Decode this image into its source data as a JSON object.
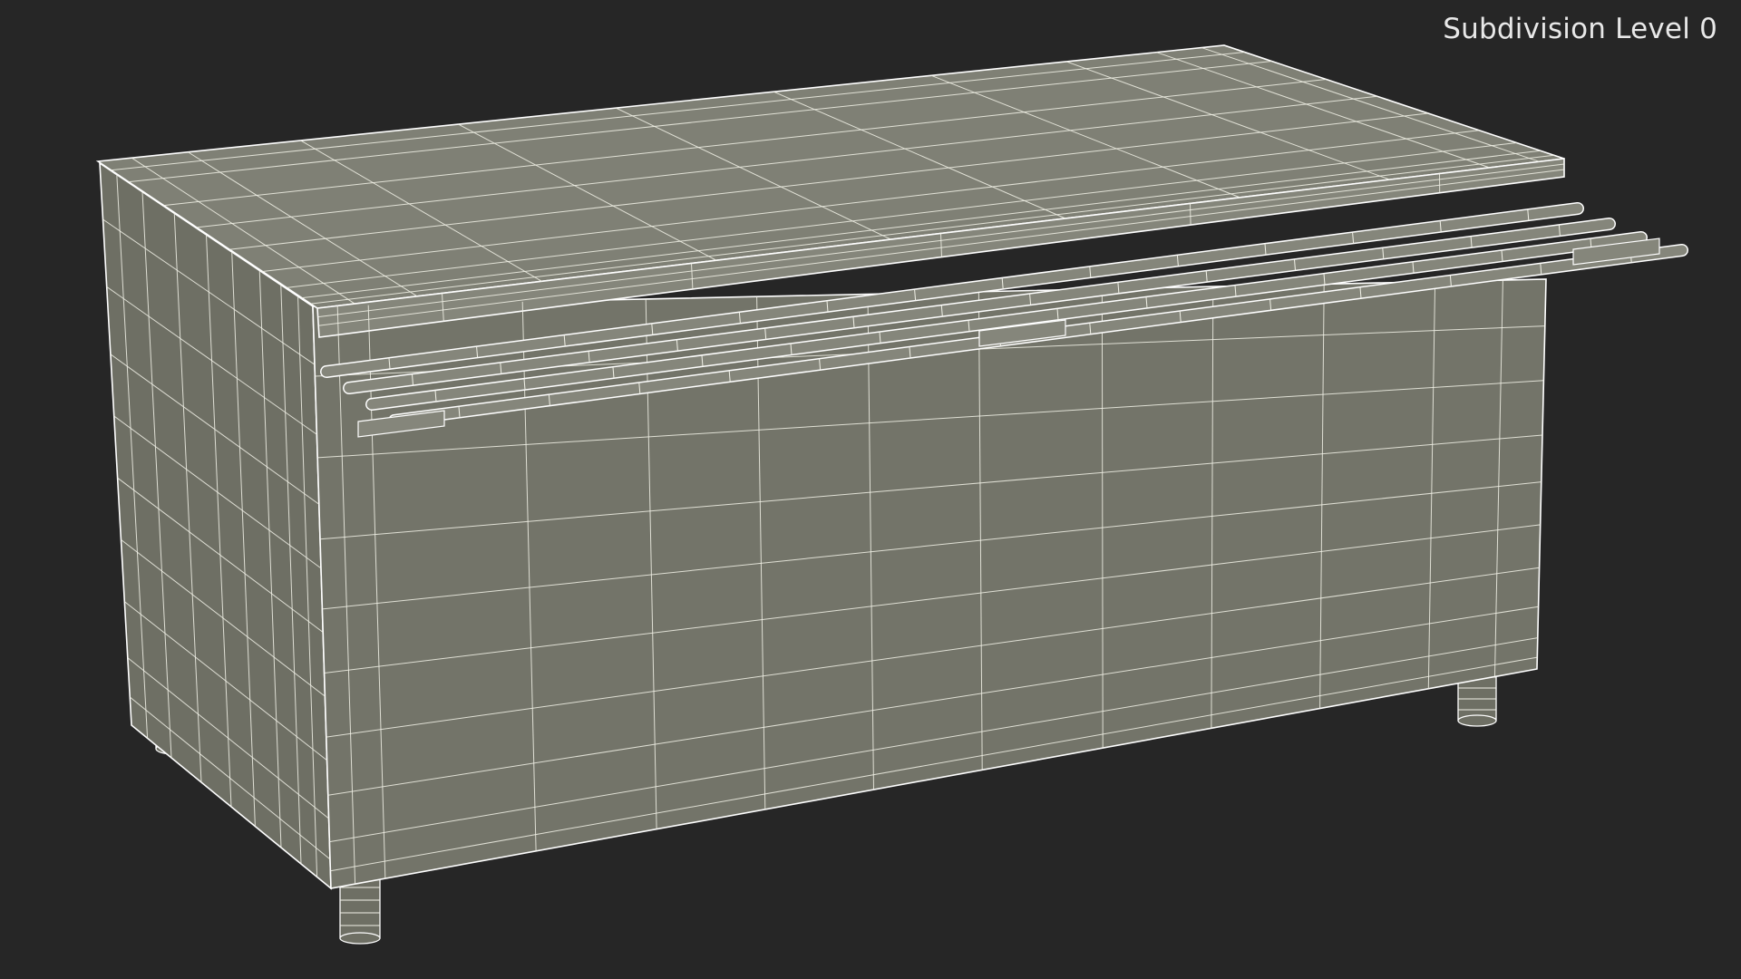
{
  "viewport": {
    "overlay_label": "Subdivision Level 0"
  },
  "model": {
    "colors": {
      "background": "#262626",
      "surface_front": "#737469",
      "surface_side": "#6e6f64",
      "surface_top": "#7f8075",
      "surface_shelf": "#85867b",
      "wire": "#f2f2e8",
      "edge": "#ffffff"
    },
    "object_icon": "wireframe-cabinet-icon"
  }
}
